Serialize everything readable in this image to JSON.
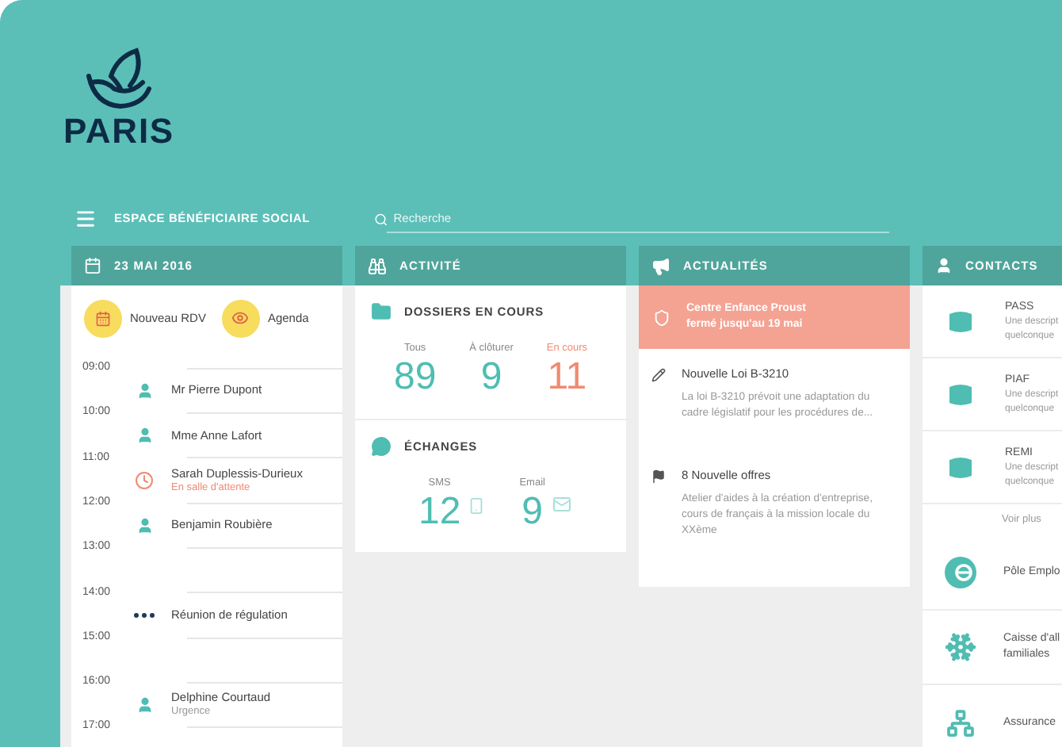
{
  "logo": {
    "wordmark": "PARIS"
  },
  "nav": {
    "title": "ESPACE BÉNÉFICIAIRE SOCIAL",
    "search": {
      "placeholder": "Recherche"
    }
  },
  "agenda": {
    "header": "23 MAI 2016",
    "actions": [
      {
        "kind": "new",
        "label": "Nouveau RDV"
      },
      {
        "kind": "view",
        "label": "Agenda"
      }
    ],
    "slots": [
      {
        "time": "09:00",
        "event": {
          "kind": "person",
          "name": "Mr Pierre Dupont"
        }
      },
      {
        "time": "10:00",
        "event": {
          "kind": "person",
          "name": "Mme Anne Lafort"
        }
      },
      {
        "time": "11:00",
        "event": {
          "kind": "waiting",
          "name": "Sarah Duplessis-Durieux",
          "note": "En salle d'attente"
        }
      },
      {
        "time": "12:00",
        "event": {
          "kind": "person",
          "name": "Benjamin Roubière"
        }
      },
      {
        "time": "13:00"
      },
      {
        "time": "14:00",
        "event": {
          "kind": "meeting",
          "name": "Réunion de régulation"
        }
      },
      {
        "time": "15:00"
      },
      {
        "time": "16:00",
        "event": {
          "kind": "person",
          "name": "Delphine Courtaud",
          "note": "Urgence"
        }
      },
      {
        "time": "17:00"
      }
    ]
  },
  "activity": {
    "header": "ACTIVITÉ",
    "sections": [
      {
        "kind": "files",
        "title": "DOSSIERS EN COURS",
        "stats": [
          {
            "label": "Tous",
            "value": "89",
            "highlighted": false
          },
          {
            "label": "À clôturer",
            "value": "9",
            "highlighted": false
          },
          {
            "label": "En cours",
            "value": "11",
            "highlighted": true
          }
        ]
      },
      {
        "kind": "messages",
        "title": "ÉCHANGES",
        "stats": [
          {
            "label": "SMS",
            "value": "12",
            "kind": "sms",
            "highlighted": false
          },
          {
            "label": "Email",
            "value": "9",
            "kind": "email",
            "highlighted": false
          }
        ]
      }
    ]
  },
  "news": {
    "header": "ACTUALITÉS",
    "alert": {
      "lines": [
        "Centre Enfance Proust",
        "fermé jusqu'au 19 mai"
      ]
    },
    "items": [
      {
        "kind": "law",
        "title": "Nouvelle Loi B-3210",
        "text": "La loi B-3210 prévoit une adaptation du cadre législatif pour les procédures de..."
      },
      {
        "kind": "offer",
        "title": "8 Nouvelle offres",
        "text": "Atelier d'aides à la création d'entreprise, cours de français à la mission locale du XXème"
      }
    ]
  },
  "contacts": {
    "header": "CONTACTS",
    "items": [
      {
        "kind": "service",
        "name": "PASS",
        "description": [
          "Une descript",
          "quelconque"
        ]
      },
      {
        "kind": "service",
        "name": "PIAF",
        "description": [
          "Une descript",
          "quelconque"
        ]
      },
      {
        "kind": "service",
        "name": "REMI",
        "description": [
          "Une descript",
          "quelconque"
        ]
      }
    ],
    "more": "Voir plus",
    "partners": [
      {
        "kind": "employment",
        "lines": [
          "Pôle Emplo"
        ]
      },
      {
        "kind": "family",
        "lines": [
          "Caisse d'all",
          "familiales"
        ]
      },
      {
        "kind": "insurance",
        "lines": [
          "Assurance"
        ]
      }
    ]
  }
}
